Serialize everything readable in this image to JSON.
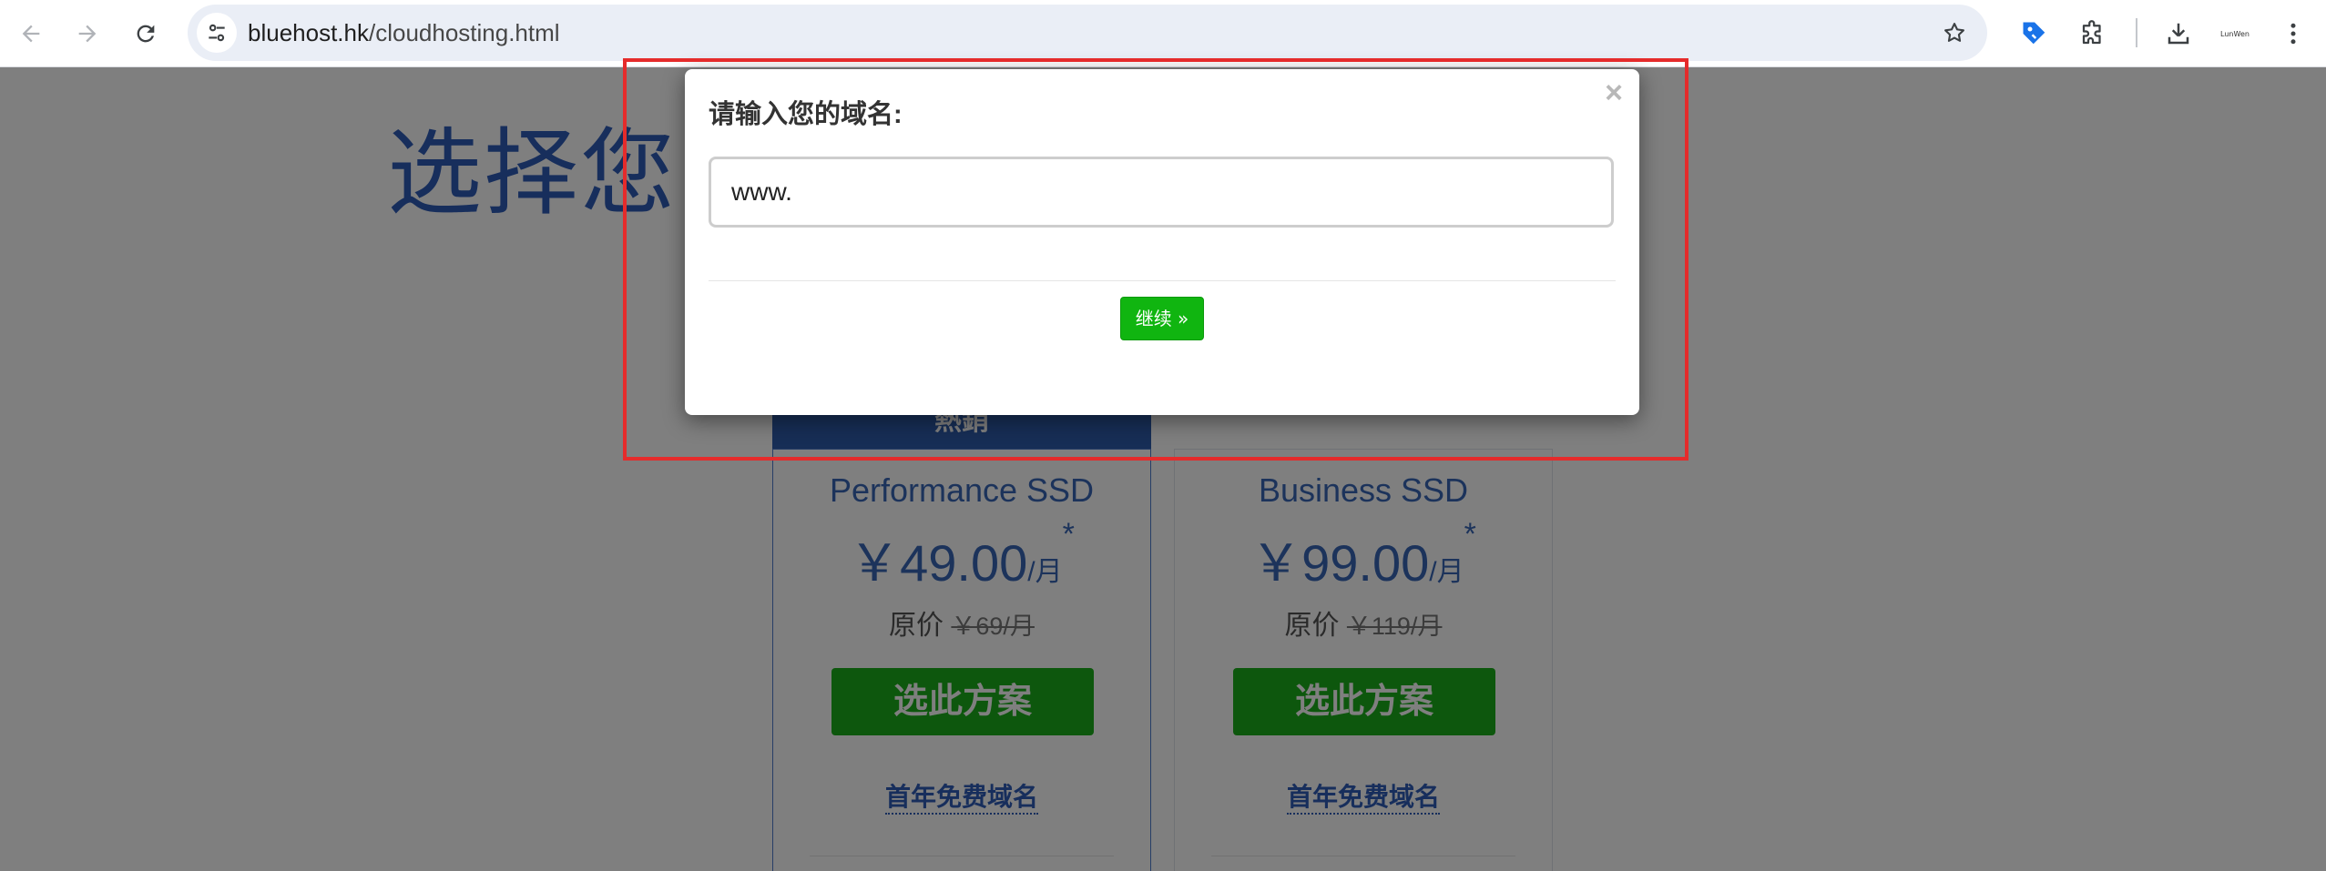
{
  "browser": {
    "url_host": "bluehost.hk",
    "url_path": "/cloudhosting.html",
    "extension_label": "LunWen",
    "icons": {
      "back": "back-arrow-icon",
      "forward": "forward-arrow-icon",
      "reload": "reload-icon",
      "site_info": "tune-icon",
      "bookmark": "star-icon",
      "extension_tag": "tag-extension-icon",
      "extensions": "puzzle-icon",
      "download": "download-icon",
      "menu": "kebab-menu-icon"
    }
  },
  "page": {
    "title": "选择您的",
    "plans": [
      {
        "banner": "熱銷",
        "name": "Performance SSD",
        "price": "￥49.00",
        "unit": "/月",
        "asterisk": "*",
        "orig_label": "原价",
        "orig_price": "￥69/月",
        "cta": "选此方案",
        "link": "首年免费域名"
      },
      {
        "name": "Business SSD",
        "price": "￥99.00",
        "unit": "/月",
        "asterisk": "*",
        "orig_label": "原价",
        "orig_price": "￥119/月",
        "cta": "选此方案",
        "link": "首年免费域名"
      }
    ]
  },
  "modal": {
    "title": "请输入您的域名:",
    "input_value": "www.",
    "continue_label": "继续 »",
    "close_symbol": "×"
  },
  "colors": {
    "brand_blue": "#2e5cb8",
    "cta_green": "#1aae1a",
    "continue_green": "#10b510",
    "annotation_red": "#e52b2b"
  }
}
